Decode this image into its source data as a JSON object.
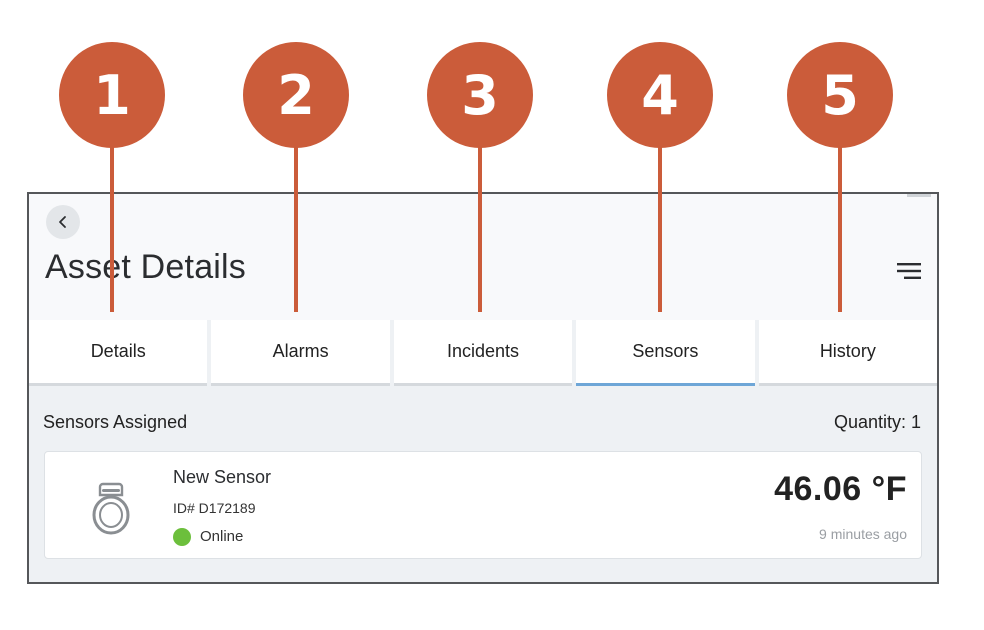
{
  "callouts": [
    "1",
    "2",
    "3",
    "4",
    "5"
  ],
  "header": {
    "title": "Asset Details",
    "back_icon": "chevron-left-icon",
    "menu_icon": "filter-menu-icon"
  },
  "tabs": [
    {
      "label": "Details",
      "active": false
    },
    {
      "label": "Alarms",
      "active": false
    },
    {
      "label": "Incidents",
      "active": false
    },
    {
      "label": "Sensors",
      "active": true
    },
    {
      "label": "History",
      "active": false
    }
  ],
  "sensors": {
    "section_label": "Sensors Assigned",
    "quantity": "Quantity: 1",
    "items": [
      {
        "name": "New Sensor",
        "id": "ID# D172189",
        "status": "Online",
        "reading": "46.06 °F",
        "updated": "9 minutes ago",
        "icon": "sensor-tag-icon"
      }
    ]
  },
  "colors": {
    "callout": "#cb5c3a",
    "active_tab": "#6ea6d7",
    "online": "#6cbf3c"
  }
}
